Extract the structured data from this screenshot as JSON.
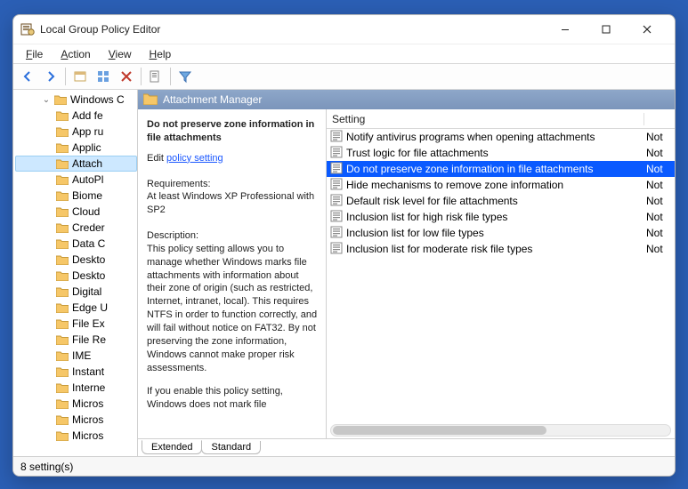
{
  "window": {
    "title": "Local Group Policy Editor"
  },
  "menu": {
    "file": "File",
    "action": "Action",
    "view": "View",
    "help": "Help"
  },
  "tree": {
    "parent": "Windows C",
    "items": [
      "Add fe",
      "App ru",
      "Applic",
      "Attach",
      "AutoPl",
      "Biome",
      "Cloud",
      "Creder",
      "Data C",
      "Deskto",
      "Deskto",
      "Digital",
      "Edge U",
      "File Ex",
      "File Re",
      "IME",
      "Instant",
      "Interne",
      "Micros",
      "Micros",
      "Micros"
    ]
  },
  "header": {
    "title": "Attachment Manager"
  },
  "desc": {
    "policy_title": "Do not preserve zone information in file attachments",
    "edit_prefix": "Edit",
    "edit_link": "policy setting",
    "req_label": "Requirements:",
    "req_text": "At least Windows XP Professional with SP2",
    "desc_label": "Description:",
    "desc_text": "This policy setting allows you to manage whether Windows marks file attachments with information about their zone of origin (such as restricted, Internet, intranet, local). This requires NTFS in order to function correctly, and will fail without notice on FAT32. By not preserving the zone information, Windows cannot make proper risk assessments.",
    "desc_text2": "If you enable this policy setting, Windows does not mark file"
  },
  "list": {
    "col_setting": "Setting",
    "col_state_trunc": "Not",
    "rows": [
      {
        "label": "Notify antivirus programs when opening attachments",
        "selected": false
      },
      {
        "label": "Trust logic for file attachments",
        "selected": false
      },
      {
        "label": "Do not preserve zone information in file attachments",
        "selected": true
      },
      {
        "label": "Hide mechanisms to remove zone information",
        "selected": false
      },
      {
        "label": "Default risk level for file attachments",
        "selected": false
      },
      {
        "label": "Inclusion list for high risk file types",
        "selected": false
      },
      {
        "label": "Inclusion list for low file types",
        "selected": false
      },
      {
        "label": "Inclusion list for moderate risk file types",
        "selected": false
      }
    ]
  },
  "tabs": {
    "extended": "Extended",
    "standard": "Standard"
  },
  "status": {
    "text": "8 setting(s)"
  }
}
